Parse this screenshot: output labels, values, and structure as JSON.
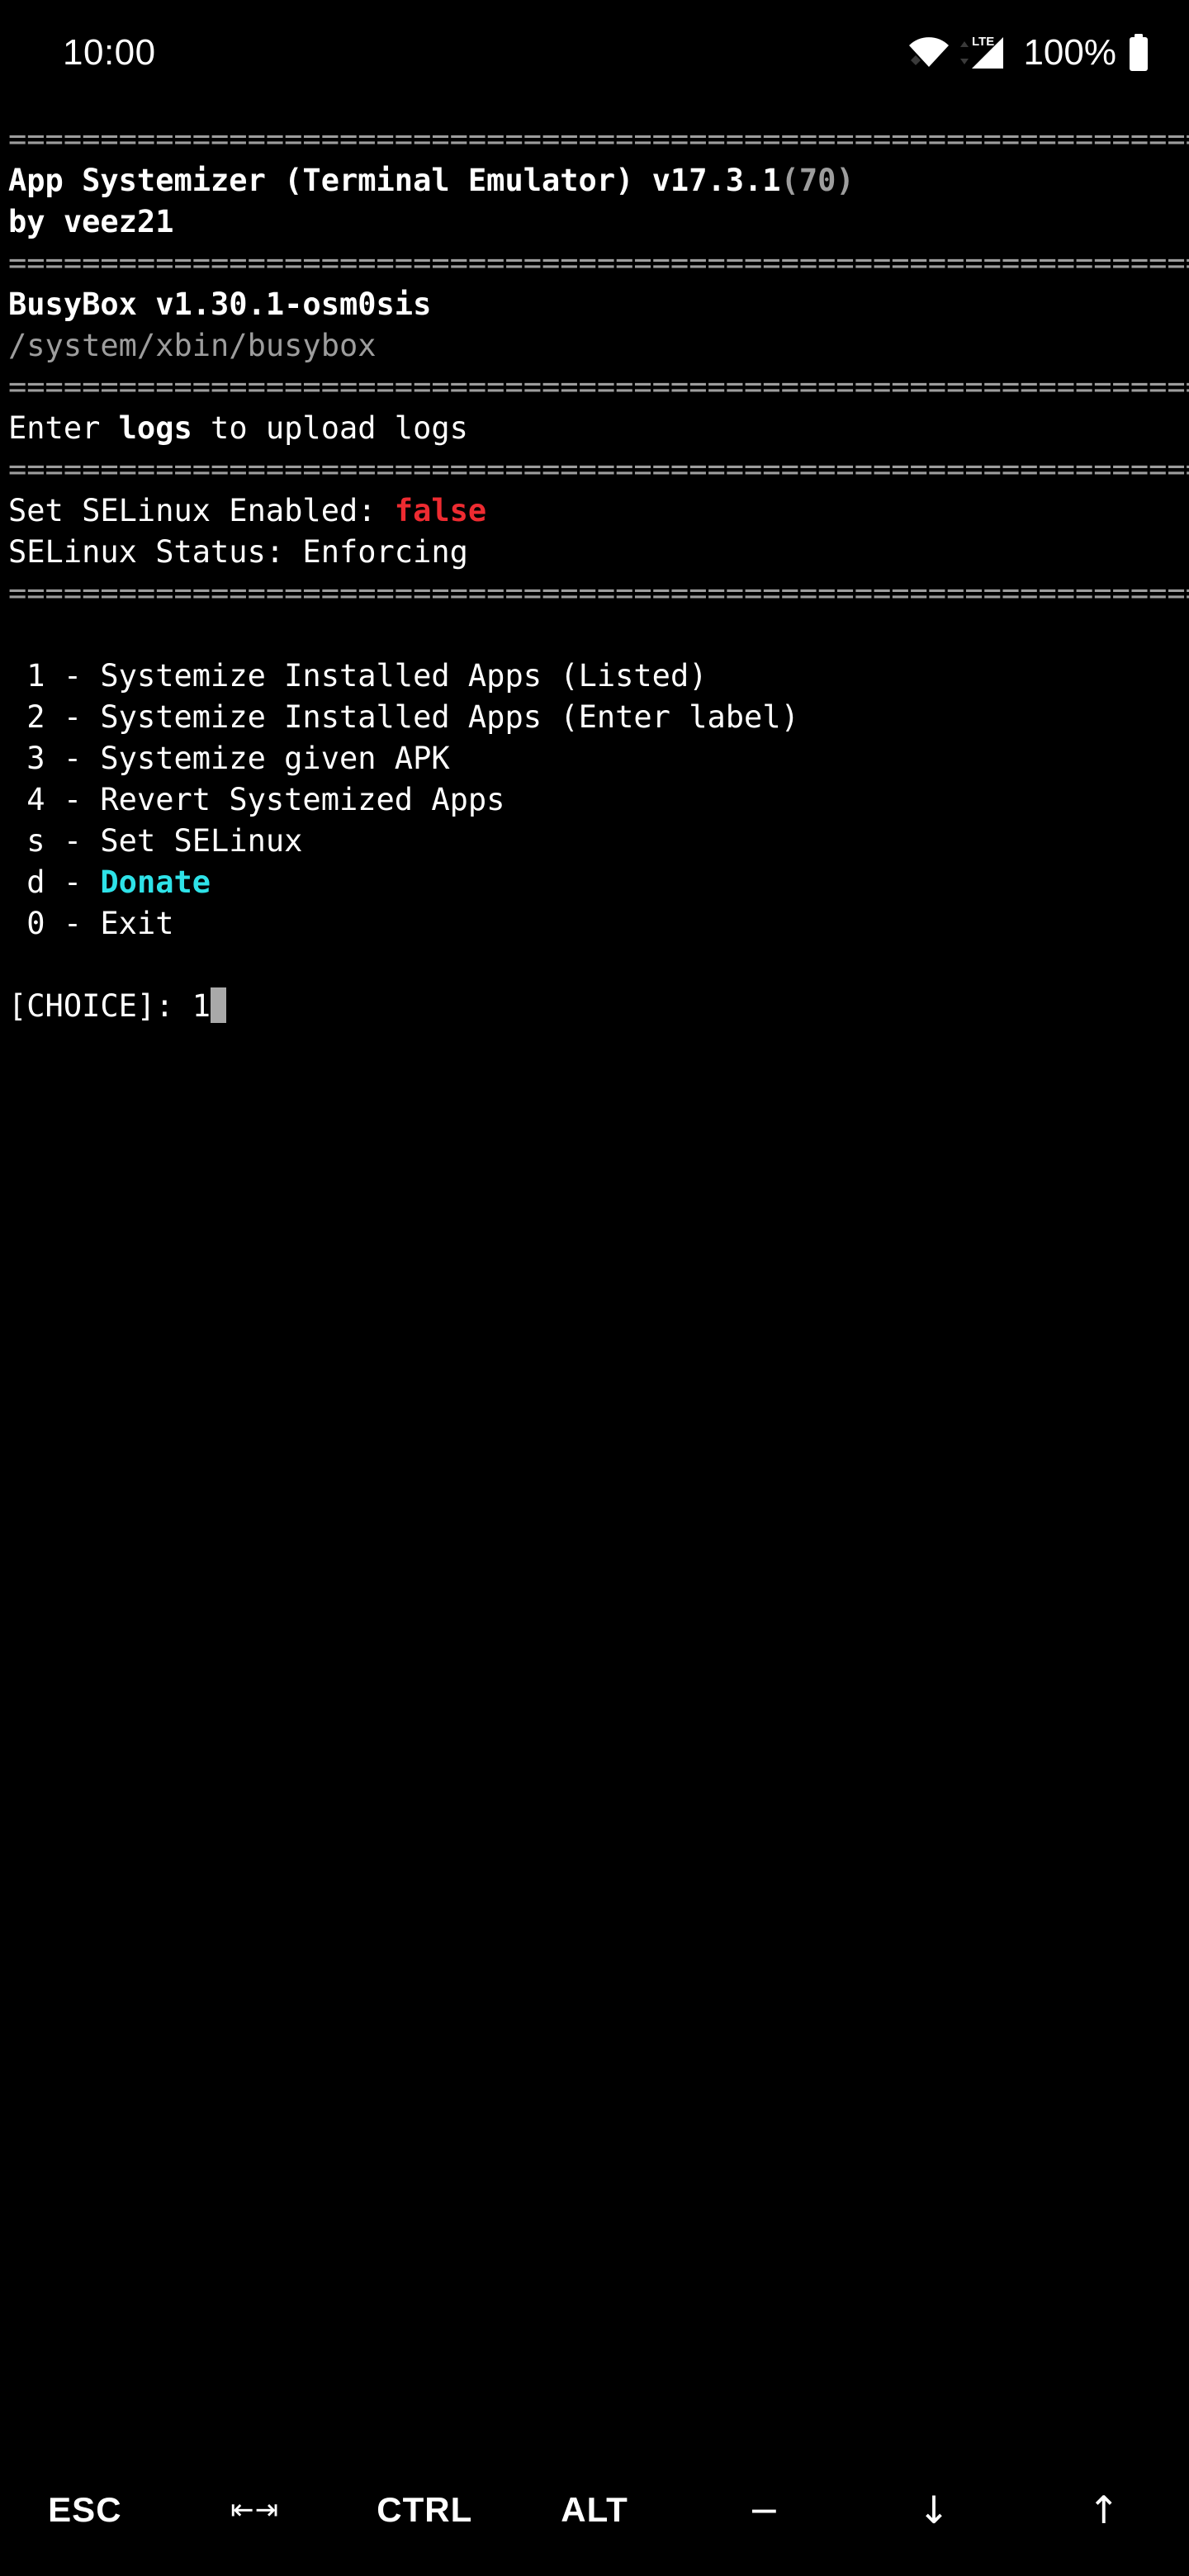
{
  "statusbar": {
    "clock": "10:00",
    "wifi_icon": "wifi-icon",
    "signal_icon": "lte-signal-icon",
    "network_label": "LTE",
    "battery_percent": "100%",
    "battery_icon": "battery-full-icon"
  },
  "terminal": {
    "separator": "========================================================================",
    "lines": [
      {
        "type": "separator"
      },
      {
        "type": "title",
        "text": "App Systemizer (Terminal Emulator) v17.3.1",
        "build": "(70)"
      },
      {
        "type": "author",
        "text": "by veez21"
      },
      {
        "type": "separator"
      },
      {
        "type": "busybox",
        "text": "BusyBox v1.30.1-osm0sis"
      },
      {
        "type": "path",
        "text": "/system/xbin/busybox"
      },
      {
        "type": "separator"
      },
      {
        "type": "hint",
        "pre": "Enter ",
        "emphasis": "logs",
        "post": " to upload logs"
      },
      {
        "type": "separator"
      },
      {
        "type": "selinux_set",
        "label": "Set SELinux Enabled: ",
        "value": "false"
      },
      {
        "type": "selinux_status",
        "text": "SELinux Status: Enforcing"
      },
      {
        "type": "separator"
      }
    ],
    "title": "App Systemizer (Terminal Emulator) v17.3.1",
    "title_build": "(70)",
    "author": "by veez21",
    "busybox_version": "BusyBox v1.30.1-osm0sis",
    "busybox_path": "/system/xbin/busybox",
    "logs_hint_pre": "Enter ",
    "logs_hint_emphasis": "logs",
    "logs_hint_post": " to upload logs",
    "selinux_set_label": "Set SELinux Enabled: ",
    "selinux_set_value": "false",
    "selinux_status": "SELinux Status: Enforcing",
    "menu": [
      {
        "key": "1",
        "sep": " - ",
        "label": "Systemize Installed Apps (Listed)",
        "style": "plain"
      },
      {
        "key": "2",
        "sep": " - ",
        "label": "Systemize Installed Apps (Enter label)",
        "style": "plain"
      },
      {
        "key": "3",
        "sep": " - ",
        "label": "Systemize given APK",
        "style": "plain"
      },
      {
        "key": "4",
        "sep": " - ",
        "label": "Revert Systemized Apps",
        "style": "plain"
      },
      {
        "key": "s",
        "sep": " - ",
        "label": "Set SELinux",
        "style": "plain"
      },
      {
        "key": "d",
        "sep": " - ",
        "label": "Donate",
        "style": "cyan"
      },
      {
        "key": "0",
        "sep": " - ",
        "label": "Exit",
        "style": "plain"
      }
    ],
    "prompt_label": "[CHOICE]: ",
    "prompt_value": "1"
  },
  "keybar": {
    "keys": [
      {
        "name": "esc-key",
        "label": "ESC",
        "glyph": false
      },
      {
        "name": "tab-key",
        "label": "⇤⇥",
        "glyph": true,
        "tabglyph": true
      },
      {
        "name": "ctrl-key",
        "label": "CTRL",
        "glyph": false
      },
      {
        "name": "alt-key",
        "label": "ALT",
        "glyph": false
      },
      {
        "name": "minus-key",
        "label": "−",
        "glyph": true
      },
      {
        "name": "arrow-down-key",
        "label": "↓",
        "glyph": true
      },
      {
        "name": "arrow-up-key",
        "label": "↑",
        "glyph": true
      }
    ]
  },
  "colors": {
    "background": "#000000",
    "foreground": "#ffffff",
    "dim": "#9d9d9d",
    "red": "#ee2b31",
    "cyan": "#2ee2e8",
    "cursor": "#a9a9a9"
  }
}
